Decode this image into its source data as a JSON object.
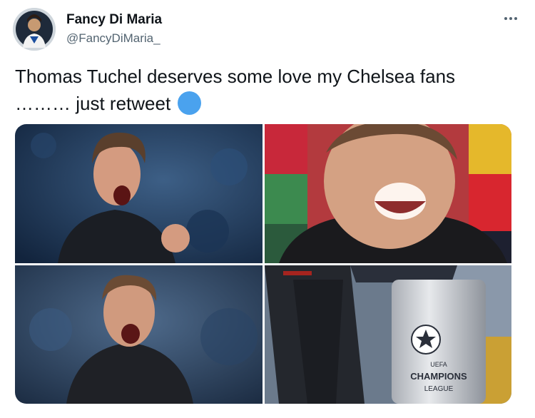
{
  "author": {
    "display_name": "Fancy Di Maria",
    "handle": "@FancyDiMaria_"
  },
  "tweet": {
    "text": "Thomas Tuchel deserves some love my Chelsea fans ……… just retweet",
    "emoji": "blue-circle-icon"
  },
  "media": {
    "count": 4,
    "trophy_text_top": "UEFA",
    "trophy_text_main": "CHAMPIONS",
    "trophy_text_bottom": "LEAGUE"
  },
  "colors": {
    "text": "#0f1419",
    "secondary": "#536471",
    "emoji_blue": "#4aa2ee"
  }
}
